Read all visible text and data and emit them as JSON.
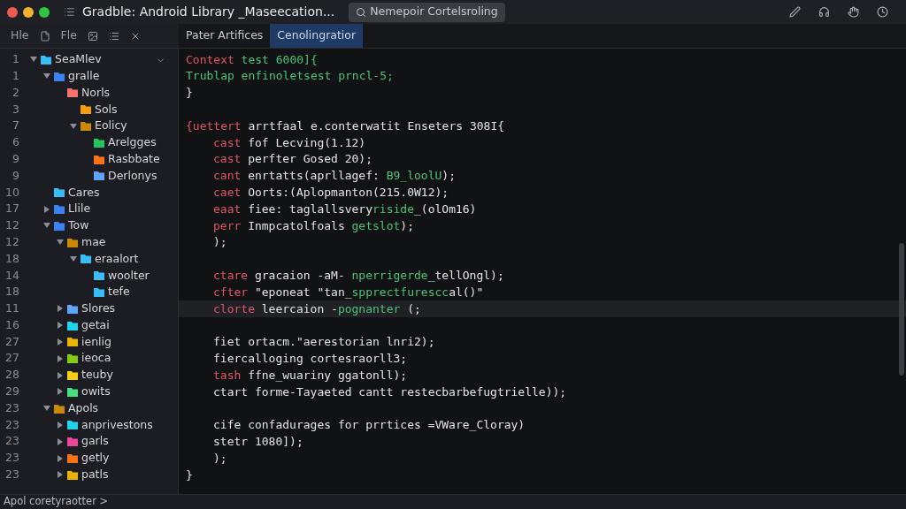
{
  "window": {
    "title": "Gradble: Android Library _Maseecation..."
  },
  "search_tab": {
    "label": "Nemepoir Cortelsroling"
  },
  "sidebar_toolbar": {
    "items": [
      "Hle",
      "Fle"
    ]
  },
  "tabs": [
    {
      "label": "Pater Artifices",
      "selected": false
    },
    {
      "label": "Cenolingratior",
      "selected": true
    }
  ],
  "tree": [
    {
      "line": "1",
      "label": "SeaMlev",
      "expanded": true,
      "color": "#38bdf8",
      "children": [
        {
          "line": "1",
          "label": "gralle",
          "expanded": true,
          "color": "#3b82f6",
          "children": [
            {
              "line": "2",
              "label": "Norls",
              "color": "#f87171",
              "children": [
                {
                  "line": "3",
                  "label": "Sols",
                  "color": "#f59e0b"
                },
                {
                  "line": "7",
                  "label": "Eolicy",
                  "expanded": true,
                  "color": "#ca8a04",
                  "children": [
                    {
                      "line": "6",
                      "label": "Arelgges",
                      "color": "#22c55e"
                    },
                    {
                      "line": "9",
                      "label": "Rasbbate",
                      "color": "#f97316"
                    },
                    {
                      "line": "9",
                      "label": "Derlonys",
                      "color": "#60a5fa"
                    }
                  ]
                }
              ]
            }
          ]
        },
        {
          "line": "10",
          "label": "Cares",
          "color": "#38bdf8"
        },
        {
          "line": "17",
          "label": "Llile",
          "expanded": false,
          "color": "#3b82f6"
        },
        {
          "line": "12",
          "label": "Tow",
          "expanded": true,
          "color": "#3b82f6",
          "children": [
            {
              "line": "12",
              "label": "mae",
              "expanded": true,
              "color": "#ca8a04",
              "children": [
                {
                  "line": "18",
                  "label": "eraalort",
                  "expanded": true,
                  "color": "#38bdf8",
                  "children": [
                    {
                      "line": "14",
                      "label": "woolter",
                      "color": "#38bdf8"
                    },
                    {
                      "line": "18",
                      "label": "tefe",
                      "color": "#38bdf8"
                    }
                  ]
                }
              ]
            },
            {
              "line": "11",
              "label": "Slores",
              "expanded": false,
              "color": "#60a5fa"
            },
            {
              "line": "16",
              "label": "getai",
              "expanded": false,
              "color": "#22d3ee"
            },
            {
              "line": "27",
              "label": "ienlig",
              "expanded": false,
              "color": "#eab308"
            },
            {
              "line": "27",
              "label": "ieoca",
              "expanded": false,
              "color": "#84cc16"
            },
            {
              "line": "28",
              "label": "teuby",
              "expanded": false,
              "color": "#facc15"
            },
            {
              "line": "29",
              "label": "owits",
              "expanded": false,
              "color": "#4ade80"
            }
          ]
        },
        {
          "line": "23",
          "label": "Apols",
          "expanded": true,
          "color": "#ca8a04",
          "children": [
            {
              "line": "23",
              "label": "anprivestons",
              "expanded": false,
              "color": "#22d3ee"
            },
            {
              "line": "23",
              "label": "garls",
              "expanded": false,
              "color": "#ec4899"
            },
            {
              "line": "23",
              "label": "getly",
              "expanded": false,
              "color": "#f97316"
            },
            {
              "line": "23",
              "label": "patls",
              "expanded": false,
              "color": "#eab308"
            }
          ]
        }
      ]
    }
  ],
  "code": [
    {
      "kind": "code",
      "indented": false,
      "highlighted": false,
      "tokens": [
        {
          "kind": "keyword",
          "text": "Context"
        },
        {
          "kind": "string",
          "text": " test 6000]{"
        }
      ]
    },
    {
      "kind": "code",
      "indented": false,
      "highlighted": false,
      "tokens": [
        {
          "kind": "string",
          "text": "Trublap enfinoletsest prncl-5;"
        }
      ]
    },
    {
      "kind": "code",
      "indented": false,
      "highlighted": false,
      "tokens": [
        {
          "kind": "plain",
          "text": "}"
        }
      ]
    },
    {
      "kind": "blank",
      "highlighted": false
    },
    {
      "kind": "code",
      "indented": false,
      "highlighted": false,
      "tokens": [
        {
          "kind": "keyword",
          "text": "{uettert"
        },
        {
          "kind": "plain",
          "text": " arrtfaal e.conterwatit Enseters 308I{"
        }
      ]
    },
    {
      "kind": "code",
      "indented": true,
      "highlighted": false,
      "tokens": [
        {
          "kind": "keyword",
          "text": "cast"
        },
        {
          "kind": "plain",
          "text": " fof Lecving(1.12)"
        }
      ]
    },
    {
      "kind": "code",
      "indented": true,
      "highlighted": false,
      "tokens": [
        {
          "kind": "keyword",
          "text": "cast"
        },
        {
          "kind": "plain",
          "text": " perfter Gosed 20);"
        }
      ]
    },
    {
      "kind": "code",
      "indented": true,
      "highlighted": false,
      "tokens": [
        {
          "kind": "keyword",
          "text": "cant"
        },
        {
          "kind": "plain",
          "text": " enrtatts(aprllagef: "
        },
        {
          "kind": "string",
          "text": "B9_loolU"
        },
        {
          "kind": "plain",
          "text": ");"
        }
      ]
    },
    {
      "kind": "code",
      "indented": true,
      "highlighted": false,
      "tokens": [
        {
          "kind": "keyword",
          "text": "caet"
        },
        {
          "kind": "plain",
          "text": " Oorts:(Aplopmanton(215.0W12);"
        }
      ]
    },
    {
      "kind": "code",
      "indented": true,
      "highlighted": false,
      "tokens": [
        {
          "kind": "keyword",
          "text": "eaat"
        },
        {
          "kind": "plain",
          "text": " fiee: taglallsvery"
        },
        {
          "kind": "string",
          "text": "riside"
        },
        {
          "kind": "plain",
          "text": "_(olOm16)"
        }
      ]
    },
    {
      "kind": "code",
      "indented": true,
      "highlighted": false,
      "tokens": [
        {
          "kind": "keyword",
          "text": "perr"
        },
        {
          "kind": "plain",
          "text": " Inmpcatolfoals "
        },
        {
          "kind": "string",
          "text": "getslot"
        },
        {
          "kind": "plain",
          "text": ");"
        }
      ]
    },
    {
      "kind": "code",
      "indented": true,
      "highlighted": false,
      "tokens": [
        {
          "kind": "plain",
          "text": ");"
        }
      ]
    },
    {
      "kind": "blank",
      "highlighted": false
    },
    {
      "kind": "code",
      "indented": true,
      "highlighted": false,
      "tokens": [
        {
          "kind": "keyword",
          "text": "ctare"
        },
        {
          "kind": "plain",
          "text": " gracaion -aM- "
        },
        {
          "kind": "string",
          "text": "nperrigerde"
        },
        {
          "kind": "plain",
          "text": "_tellOngl);"
        }
      ]
    },
    {
      "kind": "code",
      "indented": true,
      "highlighted": false,
      "tokens": [
        {
          "kind": "keyword",
          "text": "cfter"
        },
        {
          "kind": "plain",
          "text": " \"eponeat \"tan_"
        },
        {
          "kind": "string",
          "text": "spprectfurescc"
        },
        {
          "kind": "plain",
          "text": "al()\""
        }
      ]
    },
    {
      "kind": "code",
      "indented": true,
      "highlighted": true,
      "tokens": [
        {
          "kind": "keyword",
          "text": "clorte"
        },
        {
          "kind": "plain",
          "text": " leercaion -"
        },
        {
          "kind": "string",
          "text": "pognanter"
        },
        {
          "kind": "plain",
          "text": " (;"
        }
      ]
    },
    {
      "kind": "blank",
      "highlighted": false
    },
    {
      "kind": "code",
      "indented": true,
      "highlighted": false,
      "tokens": [
        {
          "kind": "plain",
          "text": "fiet ortacm.\"aerestorian lnri2);"
        }
      ]
    },
    {
      "kind": "code",
      "indented": true,
      "highlighted": false,
      "tokens": [
        {
          "kind": "plain",
          "text": "fiercalloging cortesraorll3;"
        }
      ]
    },
    {
      "kind": "code",
      "indented": true,
      "highlighted": false,
      "tokens": [
        {
          "kind": "keyword",
          "text": "tash"
        },
        {
          "kind": "plain",
          "text": " ffne_wuariny ggatonll);"
        }
      ]
    },
    {
      "kind": "code",
      "indented": true,
      "highlighted": false,
      "tokens": [
        {
          "kind": "plain",
          "text": "ctart forme-Tayaeted cantt restecbarbefugtrielle));"
        }
      ]
    },
    {
      "kind": "blank",
      "highlighted": false
    },
    {
      "kind": "code",
      "indented": true,
      "highlighted": false,
      "tokens": [
        {
          "kind": "plain",
          "text": "cife confadurages for prrtices =VWare_Cloray)"
        }
      ]
    },
    {
      "kind": "code",
      "indented": true,
      "highlighted": false,
      "tokens": [
        {
          "kind": "plain",
          "text": "stetr 1080]);"
        }
      ]
    },
    {
      "kind": "code",
      "indented": true,
      "highlighted": false,
      "tokens": [
        {
          "kind": "plain",
          "text": ");"
        }
      ]
    },
    {
      "kind": "code",
      "indented": false,
      "highlighted": false,
      "tokens": [
        {
          "kind": "plain",
          "text": "}"
        }
      ]
    }
  ],
  "status_bar": {
    "text": "Apol coretyraotter >"
  }
}
